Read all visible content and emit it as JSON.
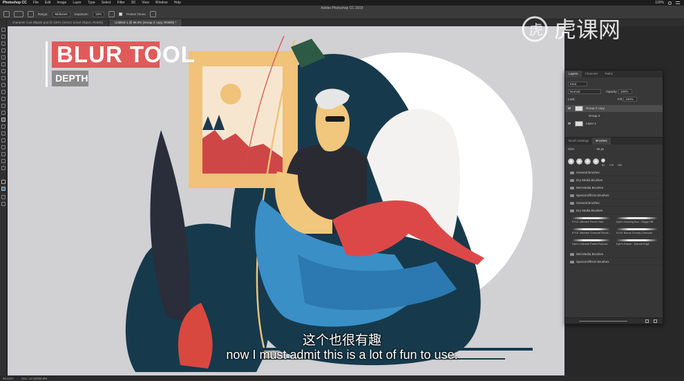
{
  "app": {
    "name": "Photoshop CC",
    "window_title": "Adobe Photoshop CC 2019",
    "menu": [
      "File",
      "Edit",
      "Image",
      "Layer",
      "Type",
      "Select",
      "Filter",
      "3D",
      "View",
      "Window",
      "Help"
    ],
    "clock": "100%"
  },
  "options": {
    "range_label": "Range:",
    "range_value": "Midtones",
    "exposure_label": "Exposure:",
    "exposure_value": "16%",
    "protect_tones": "Protect Tones"
  },
  "tabs": [
    {
      "label": "character cool ellipple.psd @ 100% (Vector Smart Object, RGB/8)"
    },
    {
      "label": "Untitled-1 @ 96.6% (Group 2 copy, RGB/8) *"
    }
  ],
  "title_card": {
    "main": "BLUR TOOL",
    "sub": "DEPTH"
  },
  "layers_panel": {
    "tabs": [
      "Layers",
      "Channels",
      "Paths"
    ],
    "kind_label": "Kind",
    "blend_mode": "Normal",
    "opacity_label": "Opacity:",
    "opacity_value": "100%",
    "lock_label": "Lock:",
    "fill_label": "Fill:",
    "fill_value": "100%",
    "layers": [
      {
        "name": "Group 2 copy"
      },
      {
        "name": "Group 2"
      },
      {
        "name": "Layer 1"
      }
    ]
  },
  "brushes_panel": {
    "tabs": [
      "Brush Settings",
      "Brushes"
    ],
    "size_label": "Size:",
    "size_value": "45 px",
    "preset_sizes": [
      "60",
      "175",
      "150"
    ],
    "folders_top": [
      "General Brushes",
      "Dry Media Brushes",
      "Wet Media Brushes",
      "Special Effects Brushes",
      "General Brushes",
      "Dry Media Brushes"
    ],
    "strokes": [
      "KYLE Ultimate Pencil Hard",
      "Kyle's Drawing Box - Happy HB",
      "KYLE Ultimate Charcoal Pencil...",
      "KYLE Bonus Chunky Charcoal",
      "Kyle's Ultimate Pastel Palooza",
      "Kyle's Eraser - Natural Edge"
    ],
    "folders_bottom": [
      "Wet Media Brushes",
      "Special Effects Brushes"
    ]
  },
  "status": {
    "zoom": "96.64%",
    "doc": "Doc: 12.0M/88.9M"
  },
  "subtitles": {
    "cn": "这个也很有趣",
    "en": "now I must admit this is a lot of fun to use."
  },
  "watermark": {
    "text": "虎课网"
  },
  "colors": {
    "accent_red": "#e05a5a",
    "deep_teal": "#163a4c",
    "chair_blue": "#3a8fc7",
    "skin": "#f1c67d",
    "sock_red": "#dc4848"
  }
}
